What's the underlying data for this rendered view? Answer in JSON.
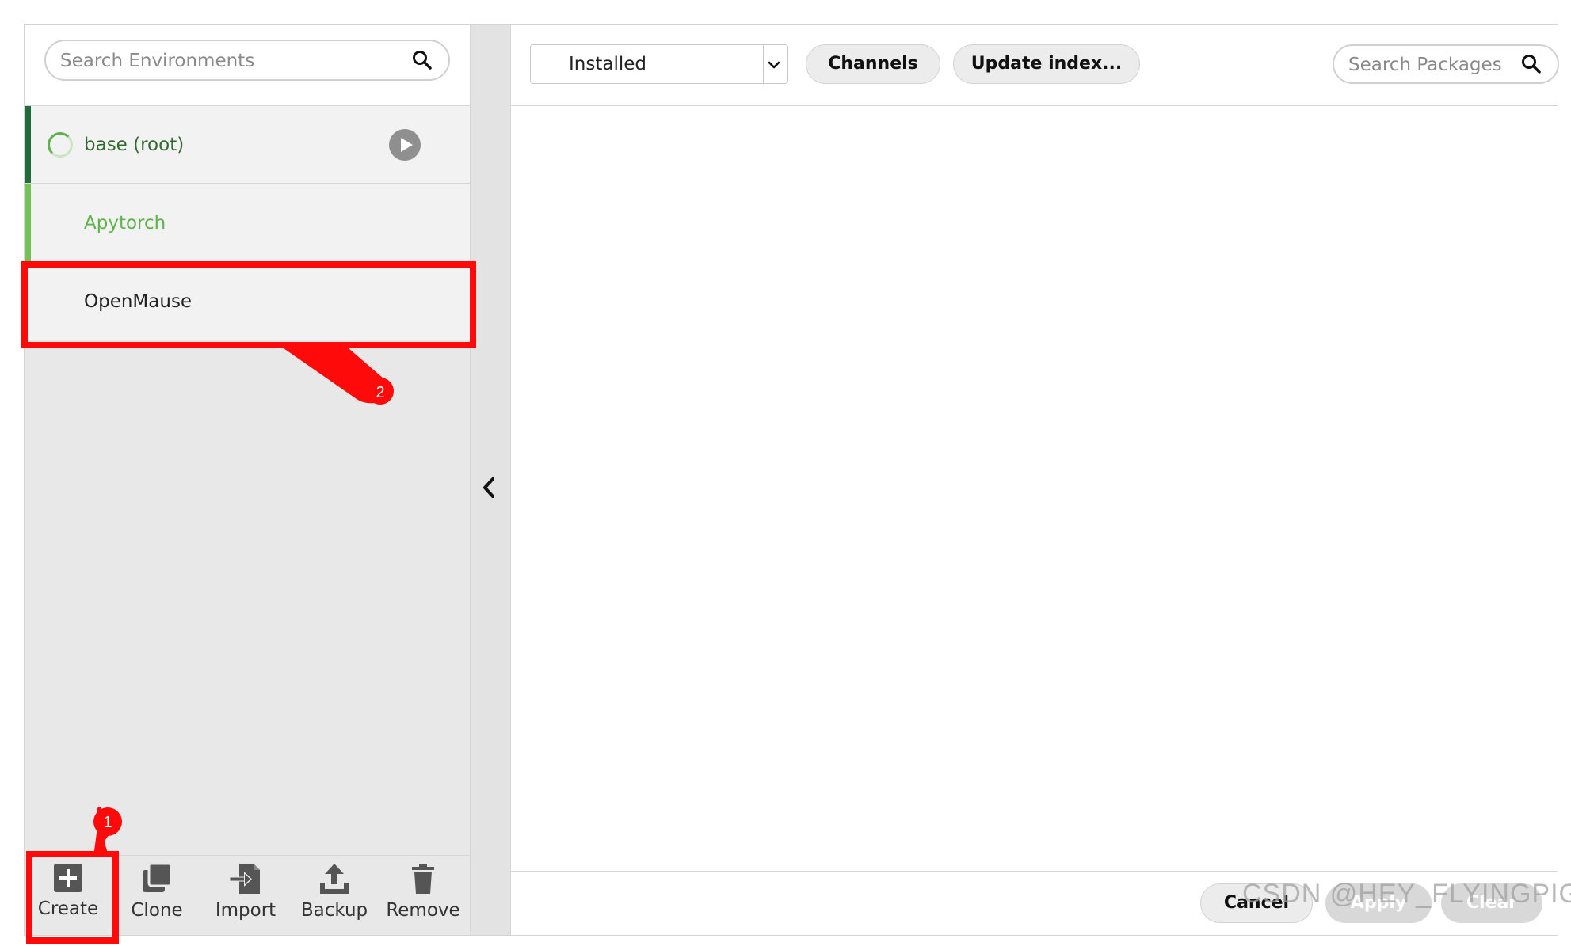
{
  "environments": {
    "search": {
      "placeholder": "Search Environments"
    },
    "items": [
      {
        "label": "base (root)",
        "status": "active",
        "label_color": "#2f6b2f"
      },
      {
        "label": "Apytorch",
        "status": "inactive",
        "label_color": "#5fb24a"
      },
      {
        "label": "OpenMause",
        "status": "inactive",
        "label_color": "#222222"
      }
    ],
    "toolbar": {
      "create_label": "Create",
      "clone_label": "Clone",
      "import_label": "Import",
      "backup_label": "Backup",
      "remove_label": "Remove"
    }
  },
  "packages": {
    "filter": {
      "selected": "Installed"
    },
    "channels_label": "Channels",
    "update_index_label": "Update index...",
    "search": {
      "placeholder": "Search Packages"
    },
    "footer": {
      "cancel_label": "Cancel",
      "apply_label": "Apply",
      "clear_label": "Clear"
    }
  },
  "annotations": {
    "callout_1": "1",
    "callout_2": "2",
    "color": "#ff0a0a"
  },
  "watermark": "CSDN @HEY_FLYINGPIG"
}
